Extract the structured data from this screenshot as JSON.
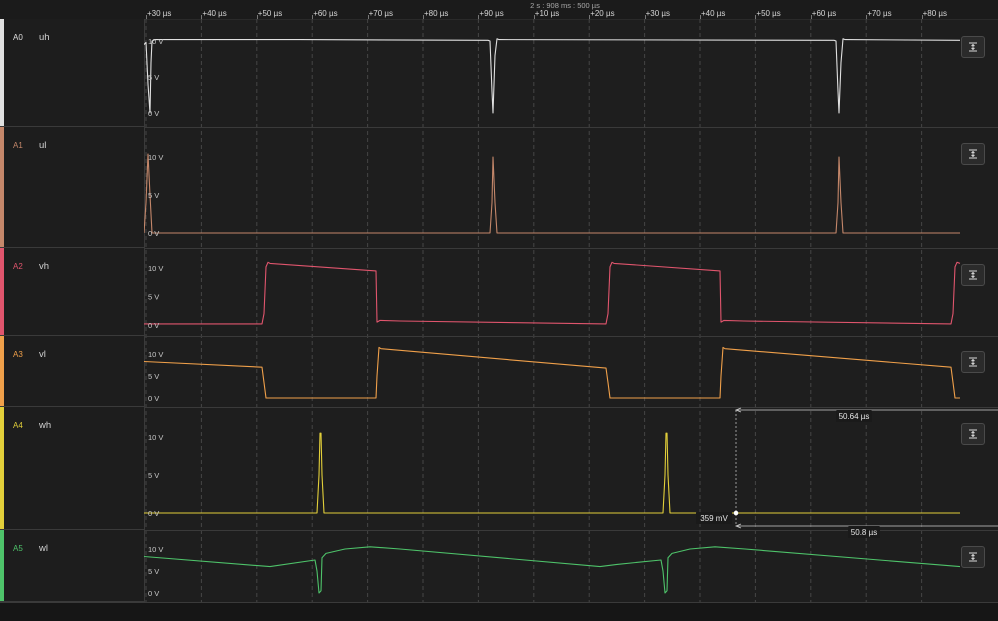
{
  "ruler": {
    "center_label": "2 s : 908 ms : 500 µs",
    "ticks": [
      "+30 µs",
      "+40 µs",
      "+50 µs",
      "+60 µs",
      "+70 µs",
      "+80 µs",
      "+90 µs",
      "+10 µs",
      "+20 µs",
      "+30 µs",
      "+40 µs",
      "+50 µs",
      "+60 µs",
      "+70 µs",
      "+80 µs"
    ]
  },
  "channels": [
    {
      "code": "A0",
      "name": "uh",
      "color": "#e0e0e0",
      "y_labels": [
        "10 V",
        "5 V",
        "0 V"
      ]
    },
    {
      "code": "A1",
      "name": "ul",
      "color": "#c4876a",
      "y_labels": [
        "10 V",
        "5 V",
        "0 V"
      ]
    },
    {
      "code": "A2",
      "name": "vh",
      "color": "#e0556d",
      "y_labels": [
        "10 V",
        "5 V",
        "0 V"
      ]
    },
    {
      "code": "A3",
      "name": "vl",
      "color": "#f0a04a",
      "y_labels": [
        "10 V",
        "5 V",
        "0 V"
      ]
    },
    {
      "code": "A4",
      "name": "wh",
      "color": "#e2cf3a",
      "y_labels": [
        "10 V",
        "5 V",
        "0 V"
      ]
    },
    {
      "code": "A5",
      "name": "wl",
      "color": "#4ec36a",
      "y_labels": [
        "10 V",
        "5 V",
        "0 V"
      ]
    }
  ],
  "measurement": {
    "cursor_value": "359 mV",
    "interval_top": "50.64 µs",
    "interval_bottom": "50.8 µs"
  },
  "icons": {
    "channel_button": "vertical-fit-icon"
  }
}
